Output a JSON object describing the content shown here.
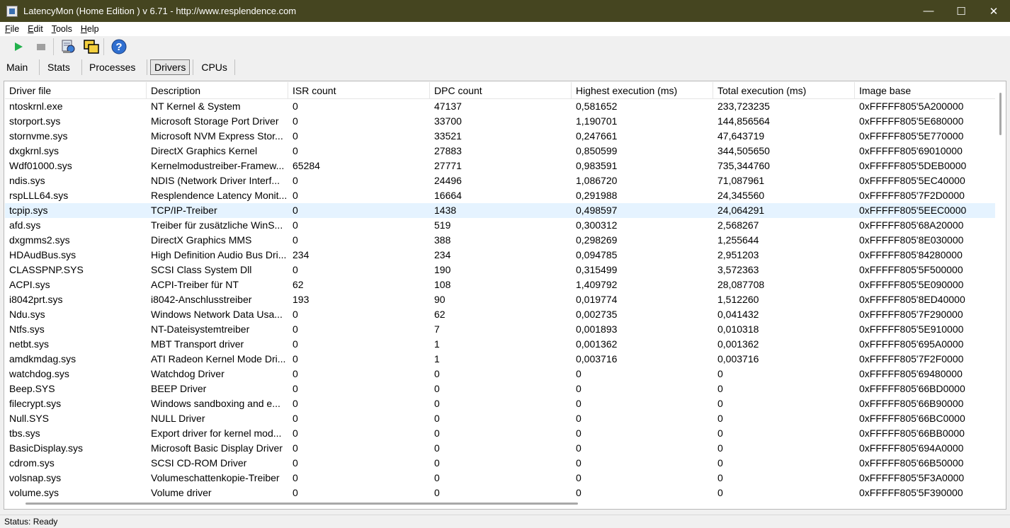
{
  "window": {
    "title": "LatencyMon  (Home Edition )  v 6.71 - http://www.resplendence.com",
    "minimize_glyph": "—",
    "maximize_glyph": "☐",
    "close_glyph": "✕"
  },
  "menu": [
    {
      "u": "F",
      "rest": "ile"
    },
    {
      "u": "E",
      "rest": "dit"
    },
    {
      "u": "T",
      "rest": "ools"
    },
    {
      "u": "H",
      "rest": "elp"
    }
  ],
  "toolbar": {
    "icons": [
      "play-icon",
      "stop-icon",
      "report-icon",
      "windows-icon",
      "help-icon"
    ]
  },
  "tabs": {
    "main": "Main",
    "stats": "Stats",
    "processes": "Processes",
    "drivers": "Drivers",
    "cpus": "CPUs",
    "active": "Drivers"
  },
  "table": {
    "columns": [
      "Driver file",
      "Description",
      "ISR count",
      "DPC count",
      "Highest execution (ms)",
      "Total execution (ms)",
      "Image base"
    ],
    "selected_row": 7,
    "rows": [
      [
        "ntoskrnl.exe",
        "NT Kernel & System",
        "0",
        "47137",
        "0,581652",
        "233,723235",
        "0xFFFFF805'5A200000"
      ],
      [
        "storport.sys",
        "Microsoft Storage Port Driver",
        "0",
        "33700",
        "1,190701",
        "144,856564",
        "0xFFFFF805'5E680000"
      ],
      [
        "stornvme.sys",
        "Microsoft NVM Express Stor...",
        "0",
        "33521",
        "0,247661",
        "47,643719",
        "0xFFFFF805'5E770000"
      ],
      [
        "dxgkrnl.sys",
        "DirectX Graphics Kernel",
        "0",
        "27883",
        "0,850599",
        "344,505650",
        "0xFFFFF805'69010000"
      ],
      [
        "Wdf01000.sys",
        "Kernelmodustreiber-Framew...",
        "65284",
        "27771",
        "0,983591",
        "735,344760",
        "0xFFFFF805'5DEB0000"
      ],
      [
        "ndis.sys",
        "NDIS (Network Driver Interf...",
        "0",
        "24496",
        "1,086720",
        "71,087961",
        "0xFFFFF805'5EC40000"
      ],
      [
        "rspLLL64.sys",
        "Resplendence Latency Monit...",
        "0",
        "16664",
        "0,291988",
        "24,345560",
        "0xFFFFF805'7F2D0000"
      ],
      [
        "tcpip.sys",
        "TCP/IP-Treiber",
        "0",
        "1438",
        "0,498597",
        "24,064291",
        "0xFFFFF805'5EEC0000"
      ],
      [
        "afd.sys",
        "Treiber für zusätzliche WinS...",
        "0",
        "519",
        "0,300312",
        "2,568267",
        "0xFFFFF805'68A20000"
      ],
      [
        "dxgmms2.sys",
        "DirectX Graphics MMS",
        "0",
        "388",
        "0,298269",
        "1,255644",
        "0xFFFFF805'8E030000"
      ],
      [
        "HDAudBus.sys",
        "High Definition Audio Bus Dri...",
        "234",
        "234",
        "0,094785",
        "2,951203",
        "0xFFFFF805'84280000"
      ],
      [
        "CLASSPNP.SYS",
        "SCSI Class System Dll",
        "0",
        "190",
        "0,315499",
        "3,572363",
        "0xFFFFF805'5F500000"
      ],
      [
        "ACPI.sys",
        "ACPI-Treiber für NT",
        "62",
        "108",
        "1,409792",
        "28,087708",
        "0xFFFFF805'5E090000"
      ],
      [
        "i8042prt.sys",
        "i8042-Anschlusstreiber",
        "193",
        "90",
        "0,019774",
        "1,512260",
        "0xFFFFF805'8ED40000"
      ],
      [
        "Ndu.sys",
        "Windows Network Data Usa...",
        "0",
        "62",
        "0,002735",
        "0,041432",
        "0xFFFFF805'7F290000"
      ],
      [
        "Ntfs.sys",
        "NT-Dateisystemtreiber",
        "0",
        "7",
        "0,001893",
        "0,010318",
        "0xFFFFF805'5E910000"
      ],
      [
        "netbt.sys",
        "MBT Transport driver",
        "0",
        "1",
        "0,001362",
        "0,001362",
        "0xFFFFF805'695A0000"
      ],
      [
        "amdkmdag.sys",
        "ATI Radeon Kernel Mode Dri...",
        "0",
        "1",
        "0,003716",
        "0,003716",
        "0xFFFFF805'7F2F0000"
      ],
      [
        "watchdog.sys",
        "Watchdog Driver",
        "0",
        "0",
        "0",
        "0",
        "0xFFFFF805'69480000"
      ],
      [
        "Beep.SYS",
        "BEEP Driver",
        "0",
        "0",
        "0",
        "0",
        "0xFFFFF805'66BD0000"
      ],
      [
        "filecrypt.sys",
        "Windows sandboxing and e...",
        "0",
        "0",
        "0",
        "0",
        "0xFFFFF805'66B90000"
      ],
      [
        "Null.SYS",
        "NULL Driver",
        "0",
        "0",
        "0",
        "0",
        "0xFFFFF805'66BC0000"
      ],
      [
        "tbs.sys",
        "Export driver for kernel mod...",
        "0",
        "0",
        "0",
        "0",
        "0xFFFFF805'66BB0000"
      ],
      [
        "BasicDisplay.sys",
        "Microsoft Basic Display Driver",
        "0",
        "0",
        "0",
        "0",
        "0xFFFFF805'694A0000"
      ],
      [
        "cdrom.sys",
        "SCSI CD-ROM Driver",
        "0",
        "0",
        "0",
        "0",
        "0xFFFFF805'66B50000"
      ],
      [
        "volsnap.sys",
        "Volumeschattenkopie-Treiber",
        "0",
        "0",
        "0",
        "0",
        "0xFFFFF805'5F3A0000"
      ],
      [
        "volume.sys",
        "Volume driver",
        "0",
        "0",
        "0",
        "0",
        "0xFFFFF805'5F390000"
      ]
    ]
  },
  "status": {
    "text": "Status: Ready"
  }
}
